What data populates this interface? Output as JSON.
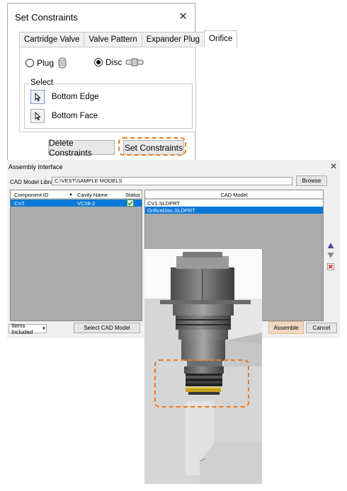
{
  "set_constraints": {
    "title": "Set Constraints",
    "close": "✕",
    "tabs": [
      {
        "label": "Cartridge Valve",
        "active": false
      },
      {
        "label": "Valve Pattern",
        "active": false
      },
      {
        "label": "Expander Plug",
        "active": false
      },
      {
        "label": "Orifice",
        "active": true
      }
    ],
    "plug_label": "Plug",
    "disc_label": "Disc",
    "selected": "disc",
    "select_group_label": "Select",
    "bottom_edge_label": "Bottom Edge",
    "bottom_face_label": "Bottom Face",
    "delete_button": "Delete Constraints",
    "set_button": "Set Constraints"
  },
  "assembly": {
    "title": "Assembly Interface",
    "close": "✕",
    "library_label": "CAD Model Library",
    "library_path": "C:\\VEST\\SAMPLE MODELS",
    "browse_button": "Browse",
    "left_grid": {
      "headers": [
        "Component ID",
        "Cavity Name",
        "Status"
      ],
      "rows": [
        {
          "component_id": "CV2",
          "cavity_name": "VC08-2",
          "status_checked": true
        }
      ]
    },
    "right_grid": {
      "header": "CAD Model",
      "rows": [
        {
          "name": "CV1.SLDPRT",
          "selected": false
        },
        {
          "name": "OrificeDisc.SLDPRT",
          "selected": true
        }
      ]
    },
    "items_dropdown": "Items Included",
    "select_cad_button": "Select CAD Model",
    "assemble_button": "Assemble",
    "cancel_button": "Cancel"
  },
  "colors": {
    "accent_orange": "#f07a1c",
    "selection_blue": "#0a78d7",
    "grid_gray": "#ababab"
  }
}
